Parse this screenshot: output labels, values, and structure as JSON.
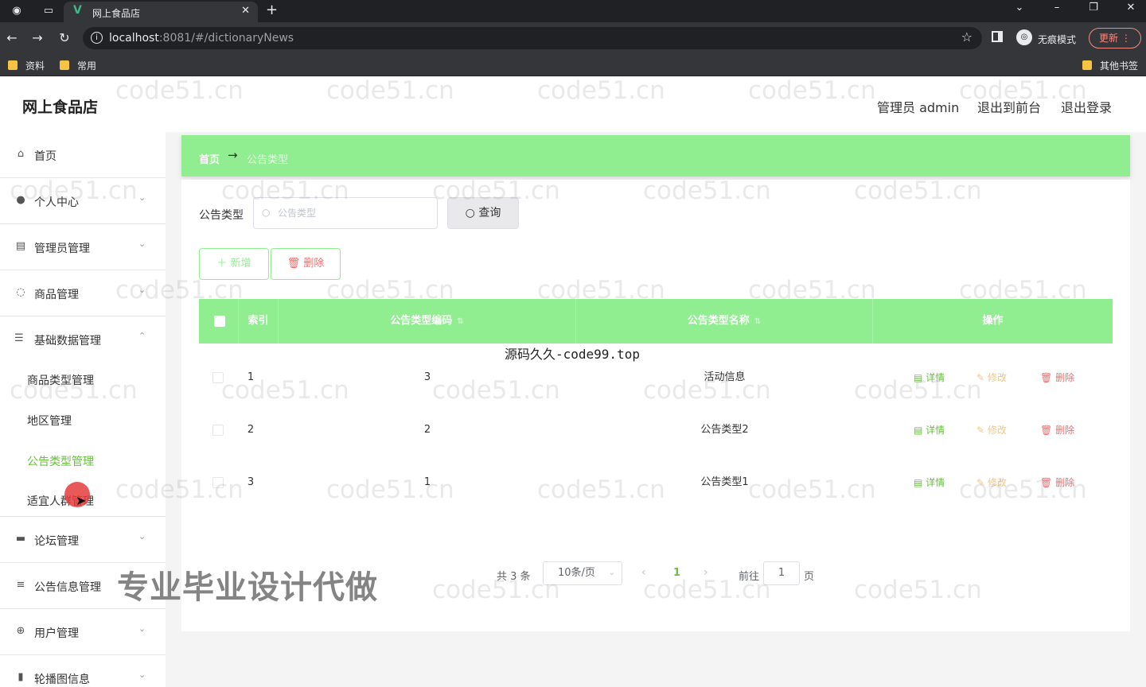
{
  "browser": {
    "tab_title": "网上食品店",
    "url_host": "localhost",
    "url_rest": ":8081/#/dictionaryNews",
    "incognito_label": "无痕模式",
    "update_label": "更新",
    "bookmarks": [
      "资料",
      "常用"
    ],
    "other_bookmarks": "其他书签"
  },
  "header": {
    "title": "网上食品店",
    "user": "管理员 admin",
    "to_front": "退出到前台",
    "logout": "退出登录"
  },
  "sidebar": {
    "items": [
      {
        "label": "首页",
        "icon": "home-icon"
      },
      {
        "label": "个人中心",
        "icon": "user-icon"
      },
      {
        "label": "管理员管理",
        "icon": "admin-icon"
      },
      {
        "label": "商品管理",
        "icon": "goods-icon"
      },
      {
        "label": "基础数据管理",
        "icon": "sliders-icon"
      },
      {
        "label": "论坛管理",
        "icon": "chat-icon"
      },
      {
        "label": "公告信息管理",
        "icon": "list-icon"
      },
      {
        "label": "用户管理",
        "icon": "users-icon"
      },
      {
        "label": "轮播图信息",
        "icon": "chart-icon"
      }
    ],
    "sub_items": [
      "商品类型管理",
      "地区管理",
      "公告类型管理",
      "适宜人群管理"
    ]
  },
  "breadcrumb": {
    "home": "首页",
    "arrow": "→",
    "current": "公告类型"
  },
  "search": {
    "label": "公告类型",
    "placeholder": "公告类型",
    "query_label": "查询"
  },
  "actions": {
    "add_label": "＋ 新增",
    "delete_label": "删除"
  },
  "table": {
    "columns": [
      "索引",
      "公告类型编码",
      "公告类型名称",
      "操作"
    ],
    "rows": [
      {
        "index": "1",
        "code": "3",
        "name": "活动信息"
      },
      {
        "index": "2",
        "code": "2",
        "name": "公告类型2"
      },
      {
        "index": "3",
        "code": "1",
        "name": "公告类型1"
      }
    ],
    "op_detail": "详情",
    "op_edit": "修改",
    "op_delete": "删除"
  },
  "pagination": {
    "total": "共 3 条",
    "page_size": "10条/页",
    "current": "1",
    "goto_label": "前往",
    "goto_value": "1",
    "goto_unit": "页"
  },
  "overlays": {
    "source_text": "源码久久-code99.top",
    "promo_text": "专业毕业设计代做",
    "watermark": "code51.cn"
  },
  "colors": {
    "accent": "#90ee90",
    "active_text": "#67c23a",
    "danger": "#f56c6c",
    "warning": "#e6a23c"
  }
}
